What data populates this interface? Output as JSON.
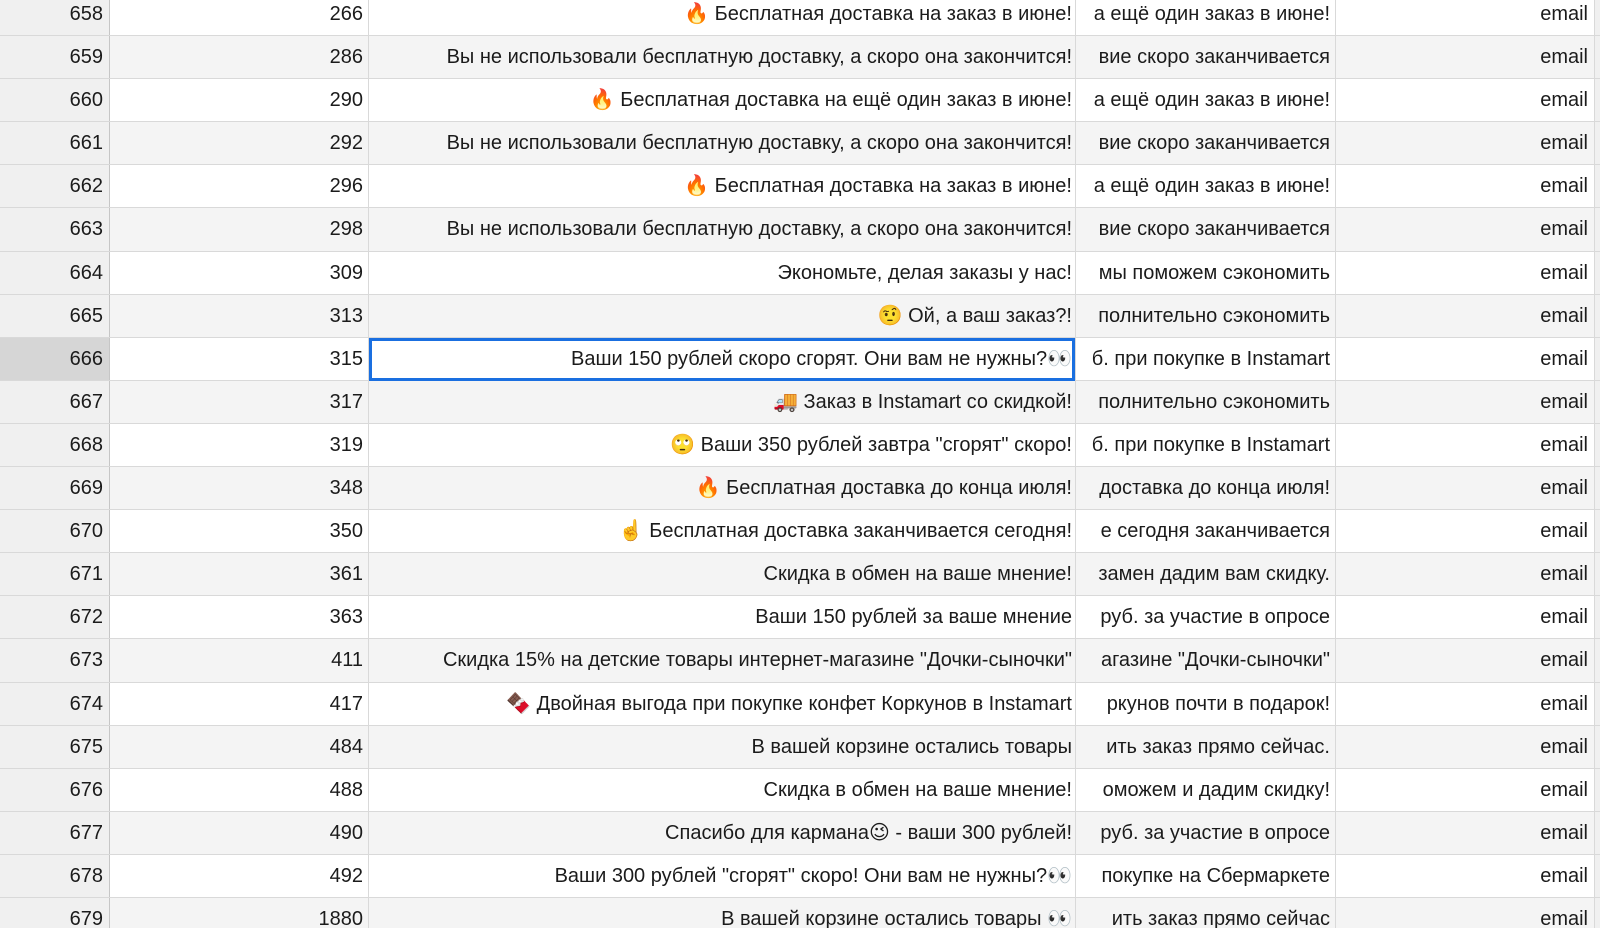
{
  "rows": [
    {
      "num": "658",
      "id": "266",
      "title": "🔥 Бесплатная доставка на заказ в июне!",
      "text": "а ещё один заказ в июне!",
      "channel": "email"
    },
    {
      "num": "659",
      "id": "286",
      "title": "Вы не использовали бесплатную доставку, а скоро она закончится!",
      "text": "вие скоро заканчивается",
      "channel": "email"
    },
    {
      "num": "660",
      "id": "290",
      "title": "🔥 Бесплатная доставка на ещё один заказ в июне!",
      "text": "а ещё один заказ в июне!",
      "channel": "email"
    },
    {
      "num": "661",
      "id": "292",
      "title": "Вы не использовали бесплатную доставку, а скоро она закончится!",
      "text": "вие скоро заканчивается",
      "channel": "email"
    },
    {
      "num": "662",
      "id": "296",
      "title": "🔥 Бесплатная доставка на заказ в июне!",
      "text": "а ещё один заказ в июне!",
      "channel": "email"
    },
    {
      "num": "663",
      "id": "298",
      "title": "Вы не использовали бесплатную доставку, а скоро она закончится!",
      "text": "вие скоро заканчивается",
      "channel": "email"
    },
    {
      "num": "664",
      "id": "309",
      "title": "Экономьте, делая заказы у нас!",
      "text": "мы поможем сэкономить",
      "channel": "email"
    },
    {
      "num": "665",
      "id": "313",
      "title": "🤨 Ой, а ваш заказ?!",
      "text": "полнительно сэкономить",
      "channel": "email"
    },
    {
      "num": "666",
      "id": "315",
      "title": "Ваши 150 рублей скоро сгорят. Они вам не нужны?👀",
      "text": "б. при покупке в Instamart",
      "channel": "email"
    },
    {
      "num": "667",
      "id": "317",
      "title": "🚚 Заказ в Instamart со скидкой!",
      "text": "полнительно сэкономить",
      "channel": "email"
    },
    {
      "num": "668",
      "id": "319",
      "title": "🙄 Ваши 350 рублей завтра \"сгорят\" скоро!",
      "text": "б. при покупке в Instamart",
      "channel": "email"
    },
    {
      "num": "669",
      "id": "348",
      "title": "🔥 Бесплатная доставка до конца июля!",
      "text": "доставка до конца июля!",
      "channel": "email"
    },
    {
      "num": "670",
      "id": "350",
      "title": "☝️ Бесплатная доставка заканчивается сегодня!",
      "text": "е сегодня заканчивается",
      "channel": "email"
    },
    {
      "num": "671",
      "id": "361",
      "title": "Скидка в обмен на ваше мнение!",
      "text": "замен дадим вам скидку.",
      "channel": "email"
    },
    {
      "num": "672",
      "id": "363",
      "title": "Ваши 150 рублей за ваше мнение",
      "text": "руб. за участие в опросе",
      "channel": "email"
    },
    {
      "num": "673",
      "id": "411",
      "title": "Скидка 15% на детские товары интернет-магазине \"Дочки-сыночки\"",
      "text": "агазине \"Дочки-сыночки\"",
      "channel": "email"
    },
    {
      "num": "674",
      "id": "417",
      "title": "🍫 Двойная выгода при покупке конфет Коркунов в Instamart",
      "text": "ркунов почти в подарок!",
      "channel": "email"
    },
    {
      "num": "675",
      "id": "484",
      "title": "В вашей корзине остались товары",
      "text": "ить заказ прямо сейчас.",
      "channel": "email"
    },
    {
      "num": "676",
      "id": "488",
      "title": "Скидка в обмен на ваше мнение!",
      "text": "оможем и дадим скидку!",
      "channel": "email"
    },
    {
      "num": "677",
      "id": "490",
      "title": "Спасибо для кармана😉 - ваши 300 рублей!",
      "text": "руб. за участие в опросе",
      "channel": "email"
    },
    {
      "num": "678",
      "id": "492",
      "title": "Ваши 300 рублей \"сгорят\" скоро! Они вам не нужны?👀",
      "text": "покупке на Сбермаркете",
      "channel": "email"
    },
    {
      "num": "679",
      "id": "1880",
      "title": "В вашей корзине остались товары 👀",
      "text": "ить заказ прямо сейчас",
      "channel": "email"
    }
  ],
  "selected_row_num": "666"
}
